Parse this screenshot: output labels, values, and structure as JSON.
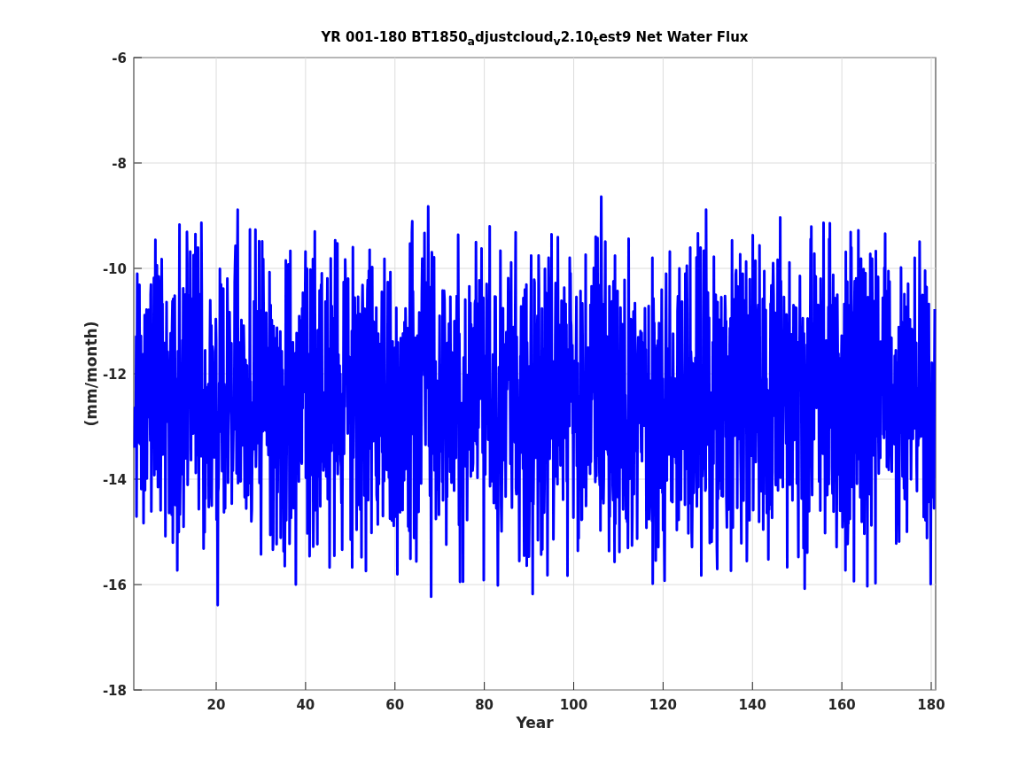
{
  "figure": {
    "title": "YR 001-180 BT1850$_{a}$djustcloud$_{v}$2.10$_{t}$est9 Net Water Flux",
    "xlabel": "Year",
    "ylabel": "(mm/month)",
    "xtick_labels": [
      "20",
      "40",
      "60",
      "80",
      "100",
      "120",
      "140",
      "160",
      "180"
    ],
    "ytick_labels": [
      "-6",
      "-8",
      "-10",
      "-12",
      "-14",
      "-16",
      "-18"
    ]
  }
}
